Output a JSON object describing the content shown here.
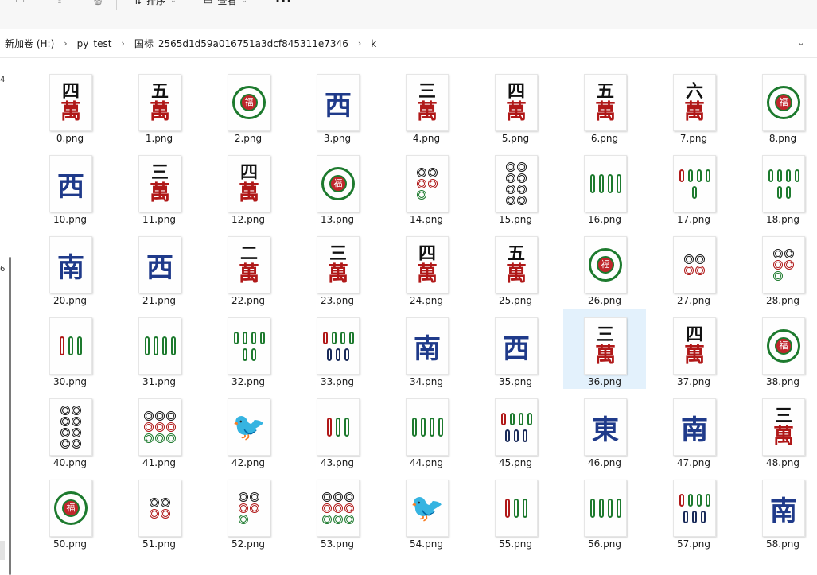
{
  "toolbar": {
    "sort_label": "排序",
    "view_label": "查看",
    "more_label": "···"
  },
  "breadcrumb": [
    "新加卷 (H:)",
    "py_test",
    "国标_2565d1d59a016751a3dcf845311e7346",
    "k"
  ],
  "left_nav_numbers": [
    "4",
    "6"
  ],
  "colors": {
    "selection": "#e3f1fc",
    "wan": "#b01818",
    "wind": "#1f3a8a",
    "bamboo": "#1d7a2e"
  },
  "files": [
    {
      "name": "0.png",
      "tile": "wan",
      "char": "四"
    },
    {
      "name": "1.png",
      "tile": "wan",
      "char": "五"
    },
    {
      "name": "2.png",
      "tile": "flower",
      "char": "福"
    },
    {
      "name": "3.png",
      "tile": "wind",
      "char": "西"
    },
    {
      "name": "4.png",
      "tile": "wan",
      "char": "三"
    },
    {
      "name": "5.png",
      "tile": "wan",
      "char": "四"
    },
    {
      "name": "6.png",
      "tile": "wan",
      "char": "五"
    },
    {
      "name": "7.png",
      "tile": "wan",
      "char": "六"
    },
    {
      "name": "8.png",
      "tile": "flower",
      "char": "福"
    },
    {
      "name": "10.png",
      "tile": "wind",
      "char": "西"
    },
    {
      "name": "11.png",
      "tile": "wan",
      "char": "三"
    },
    {
      "name": "12.png",
      "tile": "wan",
      "char": "四"
    },
    {
      "name": "13.png",
      "tile": "flower",
      "char": "福"
    },
    {
      "name": "14.png",
      "tile": "dots",
      "count": 5
    },
    {
      "name": "15.png",
      "tile": "dots",
      "count": 8
    },
    {
      "name": "16.png",
      "tile": "bamboo",
      "count": 4
    },
    {
      "name": "17.png",
      "tile": "bamboo",
      "count": 5
    },
    {
      "name": "18.png",
      "tile": "bamboo",
      "count": 6
    },
    {
      "name": "20.png",
      "tile": "wind",
      "char": "南"
    },
    {
      "name": "21.png",
      "tile": "wind",
      "char": "西"
    },
    {
      "name": "22.png",
      "tile": "wan",
      "char": "二"
    },
    {
      "name": "23.png",
      "tile": "wan",
      "char": "三"
    },
    {
      "name": "24.png",
      "tile": "wan",
      "char": "四"
    },
    {
      "name": "25.png",
      "tile": "wan",
      "char": "五"
    },
    {
      "name": "26.png",
      "tile": "flower",
      "char": "福"
    },
    {
      "name": "27.png",
      "tile": "dots",
      "count": 4
    },
    {
      "name": "28.png",
      "tile": "dots",
      "count": 5
    },
    {
      "name": "30.png",
      "tile": "bamboo",
      "count": 3
    },
    {
      "name": "31.png",
      "tile": "bamboo",
      "count": 4
    },
    {
      "name": "32.png",
      "tile": "bamboo",
      "count": 6
    },
    {
      "name": "33.png",
      "tile": "bamboo",
      "count": 7
    },
    {
      "name": "34.png",
      "tile": "wind",
      "char": "南"
    },
    {
      "name": "35.png",
      "tile": "wind",
      "char": "西"
    },
    {
      "name": "36.png",
      "tile": "wan",
      "char": "三",
      "selected": true
    },
    {
      "name": "37.png",
      "tile": "wan",
      "char": "四"
    },
    {
      "name": "38.png",
      "tile": "flower",
      "char": "福"
    },
    {
      "name": "40.png",
      "tile": "dots",
      "count": 8
    },
    {
      "name": "41.png",
      "tile": "dots",
      "count": 9
    },
    {
      "name": "42.png",
      "tile": "bird"
    },
    {
      "name": "43.png",
      "tile": "bamboo",
      "count": 3
    },
    {
      "name": "44.png",
      "tile": "bamboo",
      "count": 4
    },
    {
      "name": "45.png",
      "tile": "bamboo",
      "count": 7
    },
    {
      "name": "46.png",
      "tile": "wind",
      "char": "東"
    },
    {
      "name": "47.png",
      "tile": "wind",
      "char": "南"
    },
    {
      "name": "48.png",
      "tile": "wan",
      "char": "三"
    },
    {
      "name": "50.png",
      "tile": "flower",
      "char": "福"
    },
    {
      "name": "51.png",
      "tile": "dots",
      "count": 4
    },
    {
      "name": "52.png",
      "tile": "dots",
      "count": 5
    },
    {
      "name": "53.png",
      "tile": "dots",
      "count": 9
    },
    {
      "name": "54.png",
      "tile": "bird"
    },
    {
      "name": "55.png",
      "tile": "bamboo",
      "count": 3
    },
    {
      "name": "56.png",
      "tile": "bamboo",
      "count": 4
    },
    {
      "name": "57.png",
      "tile": "bamboo",
      "count": 7
    },
    {
      "name": "58.png",
      "tile": "wind",
      "char": "南"
    }
  ]
}
